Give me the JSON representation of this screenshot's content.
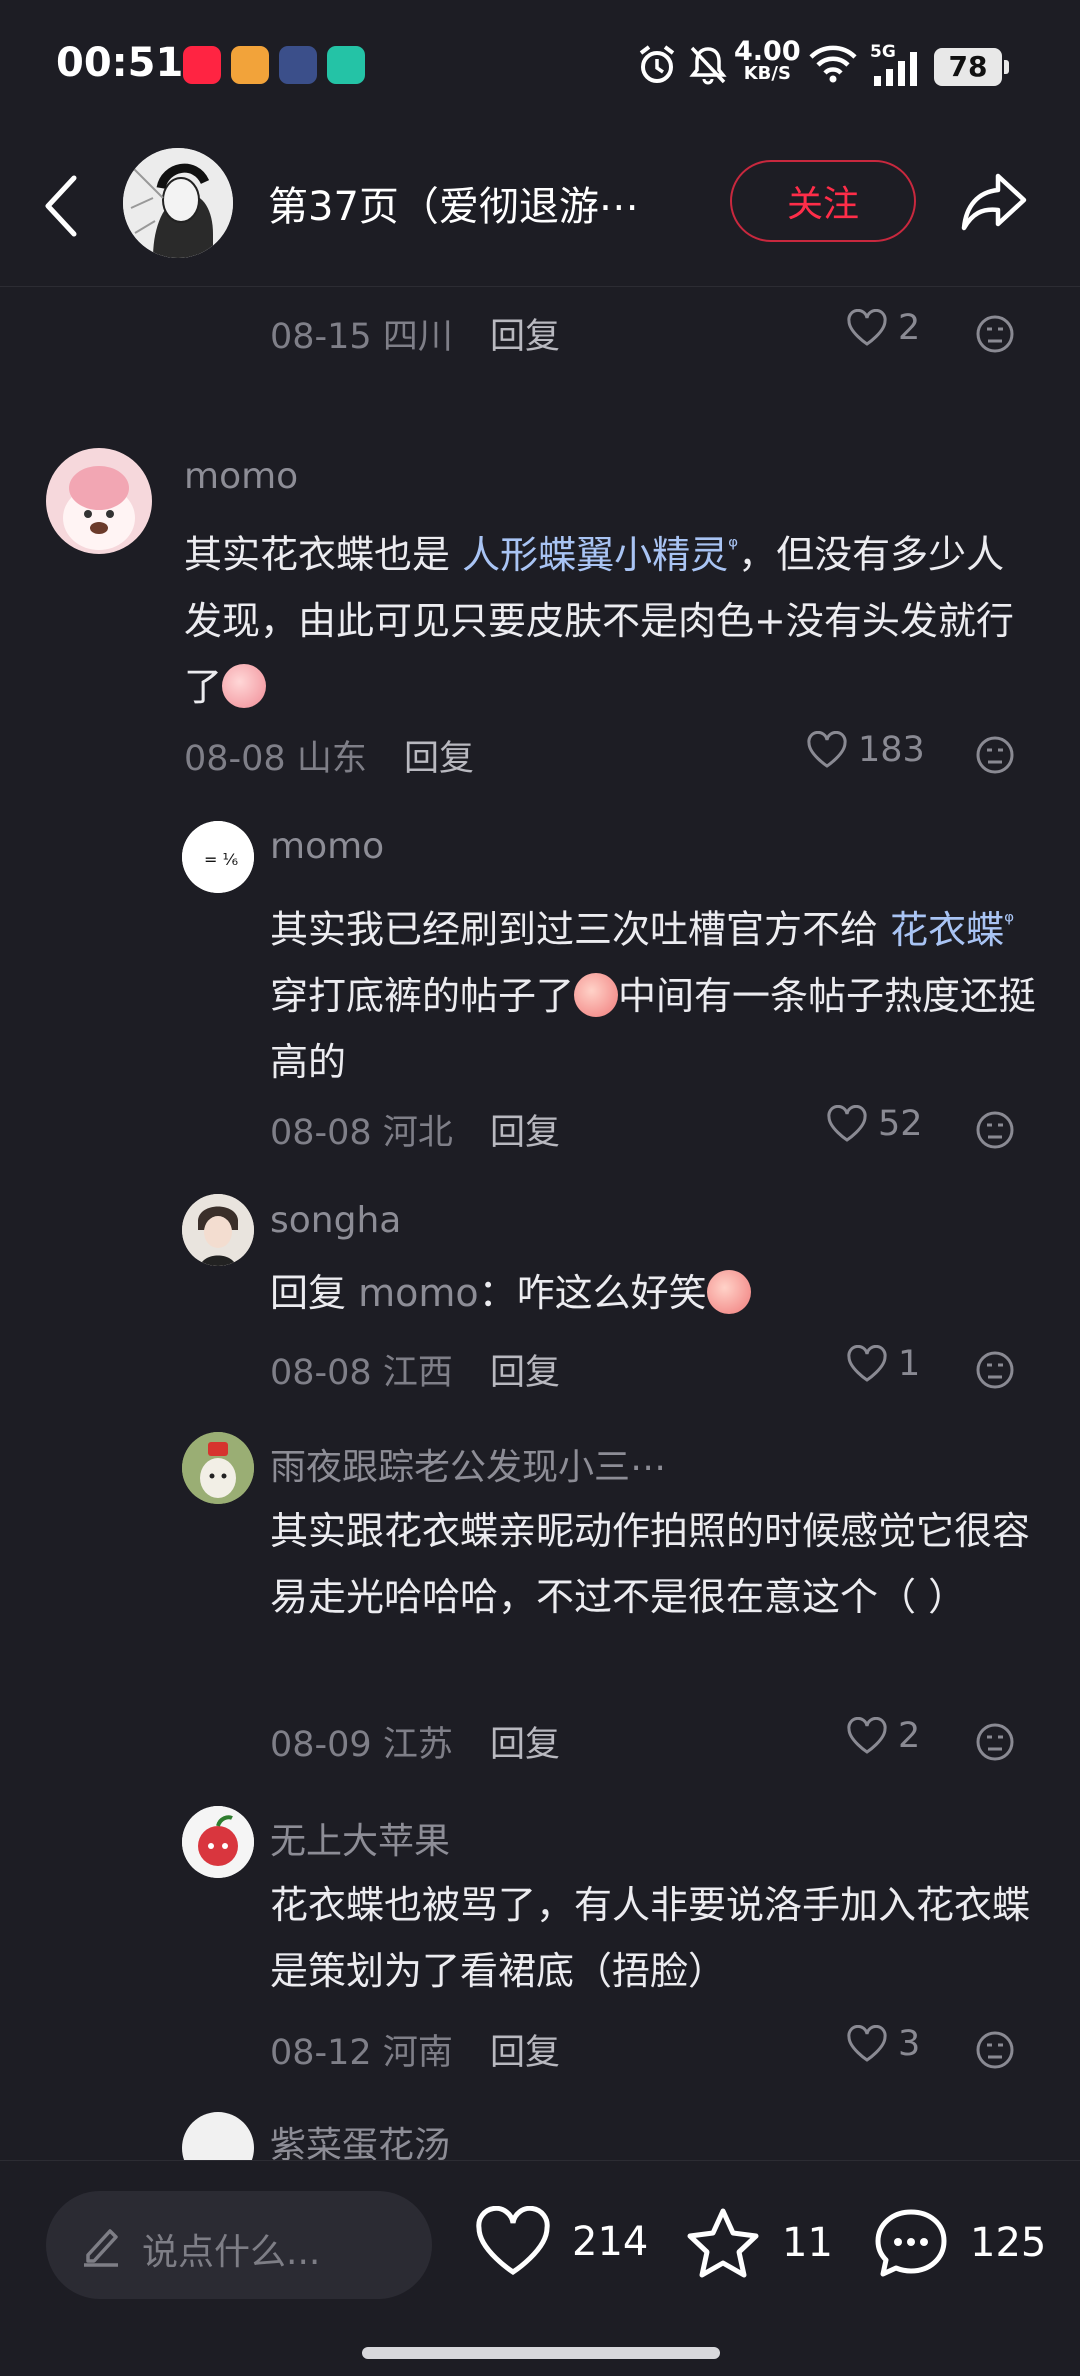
{
  "status_bar": {
    "time": "00:51",
    "net_speed_value": "4.00",
    "net_speed_unit": "KB/S",
    "signal": "5G",
    "battery": "78",
    "app_icons": [
      "xiaohongshu-icon",
      "video-app-icon",
      "game-app-icon",
      "chat-app-icon"
    ],
    "icons": [
      "alarm-icon",
      "mute-bell-icon",
      "wifi-icon",
      "signal-icon",
      "battery-icon"
    ]
  },
  "header": {
    "title": "第37页（爱彻退游⋯",
    "follow_label": "关注",
    "accent": "#ff2d49"
  },
  "comments": [
    {
      "id": "c0",
      "partial": true,
      "date": "08-15",
      "location": "四川",
      "reply_label": "回复",
      "likes": "2"
    },
    {
      "id": "c1",
      "user": "momo",
      "text_before": "其实花衣蝶也是",
      "link": "人形蝶翼小精灵",
      "text_after": "，但没有多少人发现，由此可见只要皮肤不是肉色+没有头发就行了",
      "date": "08-08",
      "location": "山东",
      "reply_label": "回复",
      "likes": "183"
    },
    {
      "id": "c2",
      "user": "momo",
      "text_before": "其实我已经刷到过三次吐槽官方不给",
      "link": "花衣蝶",
      "text_after_1": "穿打底裤的帖子了",
      "text_after_2": "中间有一条帖子热度还挺高的",
      "date": "08-08",
      "location": "河北",
      "reply_label": "回复",
      "likes": "52"
    },
    {
      "id": "c3",
      "user": "songha",
      "reply_prefix": "回复",
      "mention": "momo",
      "text": "：咋这么好笑",
      "date": "08-08",
      "location": "江西",
      "reply_label": "回复",
      "likes": "1"
    },
    {
      "id": "c4",
      "user": "雨夜跟踪老公发现小三⋯",
      "text": "其实跟花衣蝶亲昵动作拍照的时候感觉它很容易走光哈哈哈，不过不是很在意这个（ ）",
      "date": "08-09",
      "location": "江苏",
      "reply_label": "回复",
      "likes": "2"
    },
    {
      "id": "c5",
      "user": "无上大苹果",
      "text": "花衣蝶也被骂了，有人非要说洛手加入花衣蝶是策划为了看裙底（捂脸）",
      "date": "08-12",
      "location": "河南",
      "reply_label": "回复",
      "likes": "3"
    },
    {
      "id": "c6",
      "partial": true,
      "user": "紫菜蛋花汤"
    }
  ],
  "bottom_bar": {
    "input_placeholder": "说点什么...",
    "likes": "214",
    "favorites": "11",
    "comments": "125"
  }
}
